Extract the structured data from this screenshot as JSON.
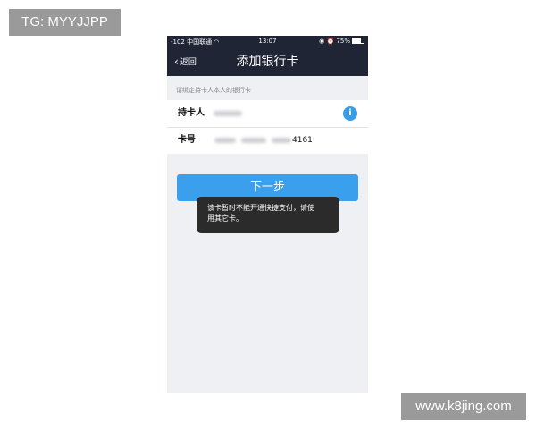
{
  "watermarks": {
    "top_left": "TG: MYYJJPP",
    "bottom_right": "www.k8jing.com"
  },
  "status_bar": {
    "carrier": "-102 中国联通",
    "wifi_icon": "wifi-icon",
    "time": "13:07",
    "battery": "75%",
    "battery_level": 0.75
  },
  "nav": {
    "back_label": "返回",
    "back_icon": "chevron-left-icon",
    "title": "添加银行卡"
  },
  "form": {
    "hint": "请绑定持卡人本人的银行卡",
    "holder_label": "持卡人",
    "card_label": "卡号",
    "card_suffix": "4161",
    "info_icon": "i"
  },
  "next_button": "下一步",
  "toast": {
    "line1": "该卡暂时不能开通快捷支付，请使",
    "line2": "用其它卡。"
  },
  "colors": {
    "navbar": "#202536",
    "background": "#eff0f4",
    "primary_button": "#3aa0ee",
    "info_icon": "#3a9be8",
    "toast": "#2b2b2b",
    "watermark": "#9a9a9a"
  }
}
